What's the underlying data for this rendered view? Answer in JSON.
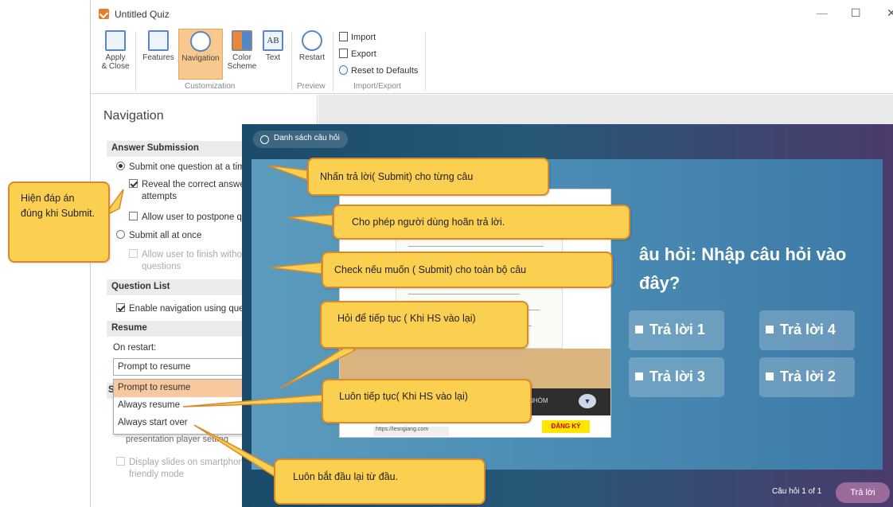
{
  "window": {
    "title": "Untitled Quiz",
    "minimize": "—",
    "maximize": "☐",
    "close": "✕"
  },
  "ribbon": {
    "apply_close": "Apply\n& Close",
    "features": "Features",
    "navigation": "Navigation",
    "color_scheme": "Color\nScheme",
    "text": "Text",
    "text_icon": "AB",
    "restart": "Restart",
    "import": "Import",
    "export": "Export",
    "reset": "Reset to Defaults",
    "group_customization": "Customization",
    "group_preview": "Preview",
    "group_import_export": "Import/Export"
  },
  "panel": {
    "title": "Navigation",
    "answer_submission": {
      "header": "Answer Submission",
      "submit_one": "Submit one question at a time",
      "reveal": "Reveal the correct answer after failed attempts",
      "postpone": "Allow user to postpone questions",
      "submit_all": "Submit all at once",
      "finish_without": "Allow user to finish without answering all questions"
    },
    "question_list": {
      "header": "Question List",
      "enable_nav": "Enable navigation using question list"
    },
    "resume": {
      "header": "Resume",
      "on_restart": "On restart:",
      "selected": "Prompt to resume",
      "options": [
        "Prompt to resume",
        "Always resume",
        "Always start over"
      ]
    },
    "hidden_header": "S",
    "partial_text": "presentation player setting",
    "smartphones": "Display slides on smartphones in m friendly mode"
  },
  "preview": {
    "list_button": "Danh sách câu hỏi",
    "question": "âu hỏi: Nhập câu hỏi vào đây?",
    "answers": [
      "Trả lời 1",
      "Trả lời 4",
      "Trả lời 3",
      "Trả lời 2"
    ],
    "counter": "Câu hỏi 1 of 1",
    "submit": "Trả lời",
    "thumb_register": "ĐĂNG KÝ",
    "thumb_url": "https://lesngiang.com",
    "thumb_label": "A NHÓM"
  },
  "callouts": {
    "left": "Hiện đáp án đúng khi Submit.",
    "submit_each": "Nhấn trả lời( Submit) cho từng câu",
    "postpone": "Cho phép  người dùng hoãn trả lời.",
    "submit_all": "Check nếu muốn ( Submit) cho toàn bộ câu",
    "prompt": "Hỏi để tiếp tục ( Khi HS vào lại)",
    "always_resume": "Luôn tiếp tục( Khi HS vào lại)",
    "start_over": "Luôn bắt đầu lại từ đầu."
  },
  "colors": {
    "callout_fill": "#fbcf50",
    "callout_border": "#d98b2b",
    "accent": "#e57e2b",
    "selected_item": "#f8c99e"
  }
}
